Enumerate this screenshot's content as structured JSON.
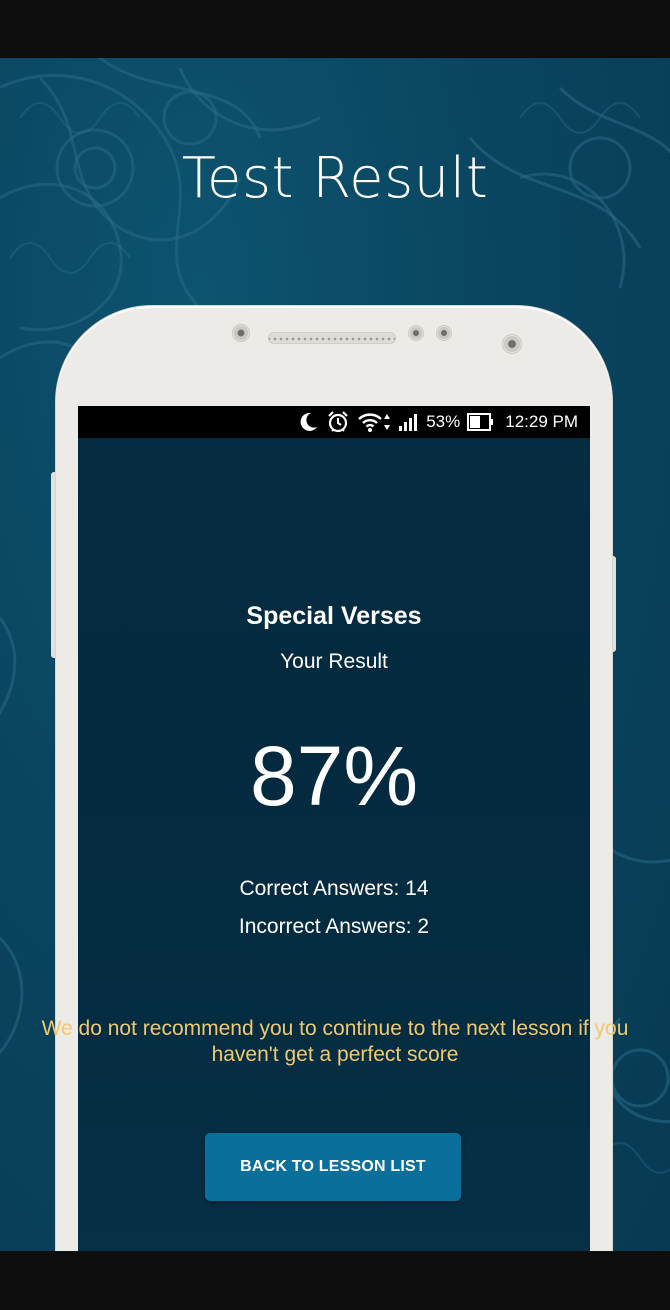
{
  "promo": {
    "title": "Test Result"
  },
  "status_bar": {
    "icons": [
      "moon-icon",
      "alarm-icon",
      "wifi-icon",
      "signal-icon",
      "battery-icon"
    ],
    "battery": "53%",
    "time": "12:29 PM"
  },
  "result": {
    "lesson_title": "Special Verses",
    "subtitle": "Your Result",
    "score": "87%",
    "correct": "Correct Answers: 14",
    "incorrect": "Incorrect Answers: 2",
    "warning": "We do not recommend you to continue to the next lesson if you haven't get a perfect score",
    "back_button": "BACK TO LESSON LIST"
  },
  "colors": {
    "background": "#0a4560",
    "screen": "#032a3e",
    "accent_button": "#0b6f9b",
    "warning_text": "#f2c86d"
  }
}
